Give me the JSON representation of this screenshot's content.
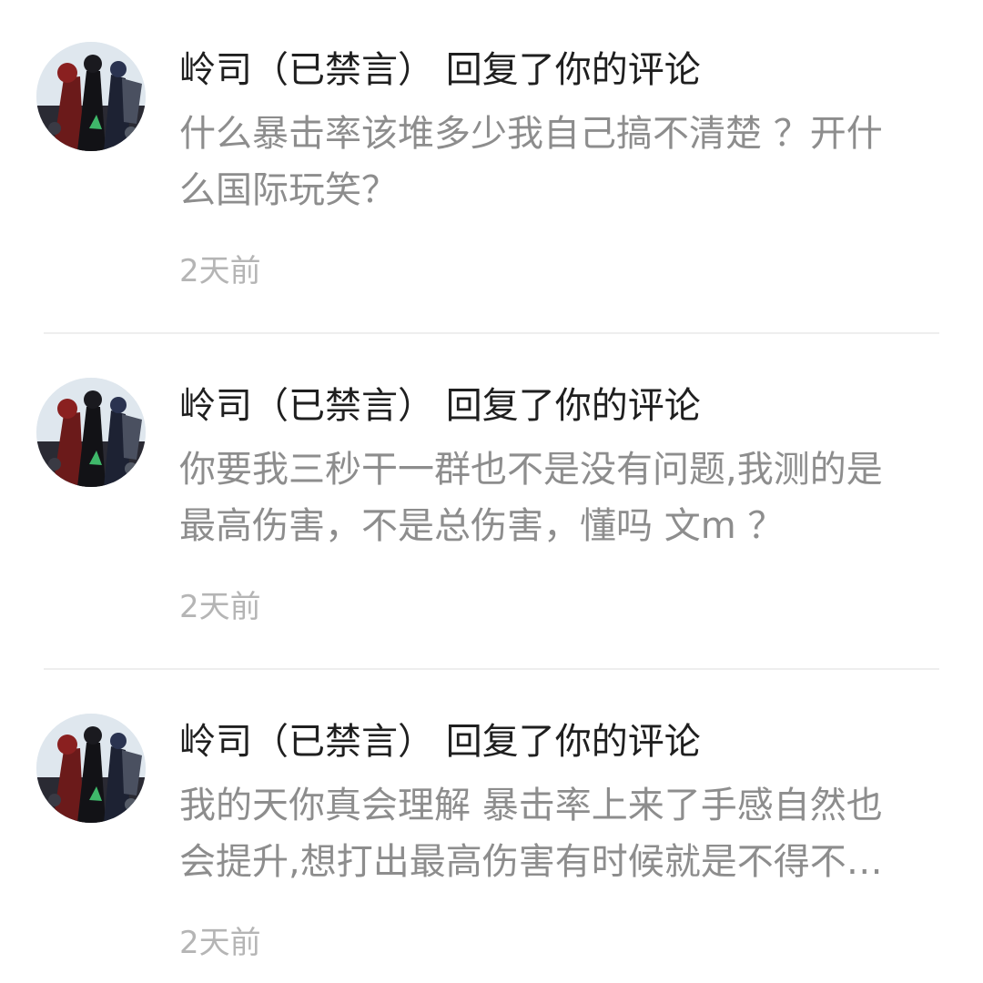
{
  "notifications": [
    {
      "title": "岭司（已禁言） 回复了你的评论",
      "body": "什么暴击率该堆多少我自己搞不清楚 ？开什\n么国际玩笑？",
      "time": "2天前"
    },
    {
      "title": "岭司（已禁言） 回复了你的评论",
      "body": "你要我三秒干一群也不是没有问题,我测的是\n最高伤害，不是总伤害，懂吗 文m ？",
      "time": "2天前"
    },
    {
      "title": "岭司（已禁言） 回复了你的评论",
      "body": "我的天你真会理解 暴击率上来了手感自然也\n会提升,想打出最高伤害有时候就是不得不…",
      "time": "2天前"
    }
  ],
  "colors": {
    "title": "#1f1f1f",
    "body": "#8d8d8d",
    "time": "#b5b5b5",
    "divider": "#eeeeee"
  }
}
